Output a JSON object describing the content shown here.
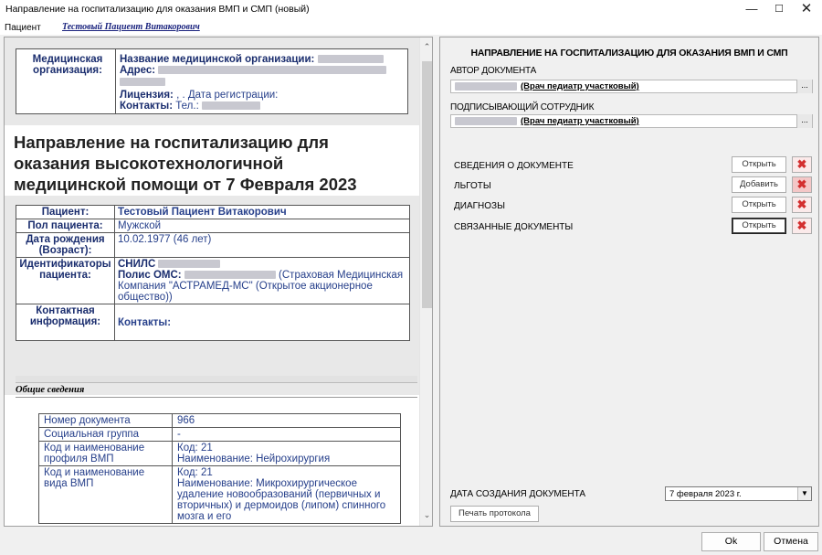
{
  "window": {
    "title": "Направление на госпитализацию для оказания ВМП и СМП (новый)",
    "min_glyph": "—",
    "max_glyph": "☐",
    "close_glyph": "✕"
  },
  "patient_bar": {
    "label": "Пациент",
    "name": "Тестовый Пациент Витакорович"
  },
  "document": {
    "org": {
      "label": "Медицинская организация:",
      "name_label": "Название медицинской организации:",
      "address_label": "Адрес:",
      "license_label": "Лицензия:",
      "license_value": ", . Дата регистрации:",
      "contacts_label": "Контакты:",
      "contacts_value": "Тел.:"
    },
    "heading": "Направление на госпитализацию для оказания высокотехнологичной медицинской помощи от 7 Февраля 2023",
    "patient_rows": [
      {
        "key": "Пациент:",
        "value": "Тестовый Пациент Витакорович"
      },
      {
        "key": "Пол пациента:",
        "value": "Мужской"
      },
      {
        "key": "Дата рождения (Возраст):",
        "value": "10.02.1977 (46 лет)"
      },
      {
        "key": "Идентификаторы пациента:",
        "snils_label": "СНИЛС",
        "oms_label": "Полис ОМС:",
        "oms_value": "(Страховая Медицинская Компания \"АСТРАМЕД-МС\" (Открытое акционерное общество))"
      },
      {
        "key": "Контактная информация:",
        "value": "Контакты:"
      }
    ],
    "section_title": "Общие сведения",
    "info_rows": [
      {
        "key": "Номер документа",
        "value": "966"
      },
      {
        "key": "Социальная группа",
        "value": "-"
      },
      {
        "key": "Код и наименование профиля ВМП",
        "line1": "Код: 21",
        "line2": "Наименование: Нейрохирургия"
      },
      {
        "key": "Код и наименование вида ВМП",
        "line1": "Код: 21",
        "line2": "Наименование: Микрохирургическое удаление новообразований (первичных и вторичных) и дермоидов (липом) спинного мозга и его"
      }
    ]
  },
  "right_panel": {
    "title": "НАПРАВЛЕНИЕ НА ГОСПИТАЛИЗАЦИЮ ДЛЯ ОКАЗАНИЯ ВМП И СМП",
    "author_label": "АВТОР ДОКУМЕНТА",
    "author_value": "(Врач педиатр участковый)",
    "signer_label": "ПОДПИСЫВАЮЩИЙ СОТРУДНИК",
    "signer_value": "(Врач педиатр участковый)",
    "browse_glyph": "...",
    "sections": [
      {
        "label": "СВЕДЕНИЯ О ДОКУМЕНТЕ",
        "button": "Открыть"
      },
      {
        "label": "ЛЬГОТЫ",
        "button": "Добавить"
      },
      {
        "label": "ДИАГНОЗЫ",
        "button": "Открыть"
      },
      {
        "label": "СВЯЗАННЫЕ ДОКУМЕНТЫ",
        "button": "Открыть"
      }
    ],
    "delete_glyph": "✖",
    "date_label": "ДАТА СОЗДАНИЯ ДОКУМЕНТА",
    "date_value": "7 февраля  2023 г.",
    "dropdown_glyph": "▼",
    "print_button": "Печать протокола"
  },
  "footer": {
    "ok": "Ok",
    "cancel": "Отмена"
  },
  "scroll_glyphs": {
    "up": "⌃",
    "down": "⌄"
  },
  "colors": {
    "accent_navy": "#1a2d6e",
    "link_blue": "#27408b",
    "delete_red": "#d32f2f"
  }
}
